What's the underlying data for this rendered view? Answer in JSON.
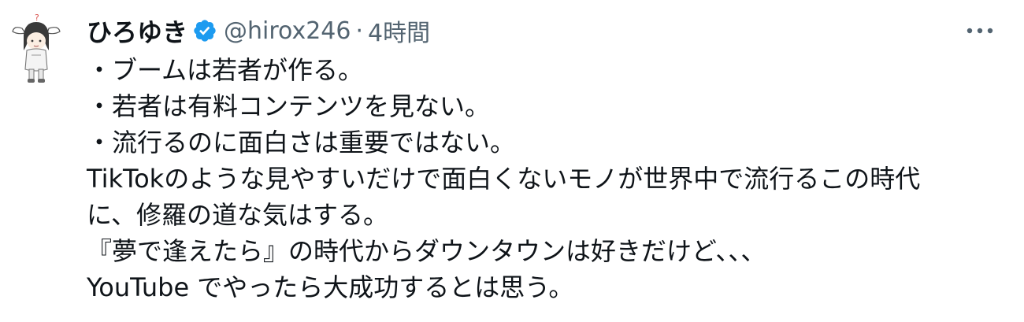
{
  "tweet": {
    "author": {
      "display_name": "ひろゆき",
      "handle": "@hirox246",
      "verified": true
    },
    "separator": "·",
    "timestamp": "4時間",
    "more_icon": "more-horizontal-icon",
    "verified_icon": "verified-badge-icon",
    "body_lines": [
      "・ブームは若者が作る。",
      "・若者は有料コンテンツを見ない。",
      "・流行るのに面白さは重要ではない。",
      "TikTokのような見やすいだけで面白くないモノが世界中で流行るこの時代",
      "に、修羅の道な気はする。",
      "『夢で逢えたら』の時代からダウンタウンは好きだけど、、、",
      "YouTube でやったら大成功するとは思う。"
    ],
    "colors": {
      "text": "#0f1419",
      "secondary": "#536471",
      "verified": "#1d9bf0"
    }
  }
}
